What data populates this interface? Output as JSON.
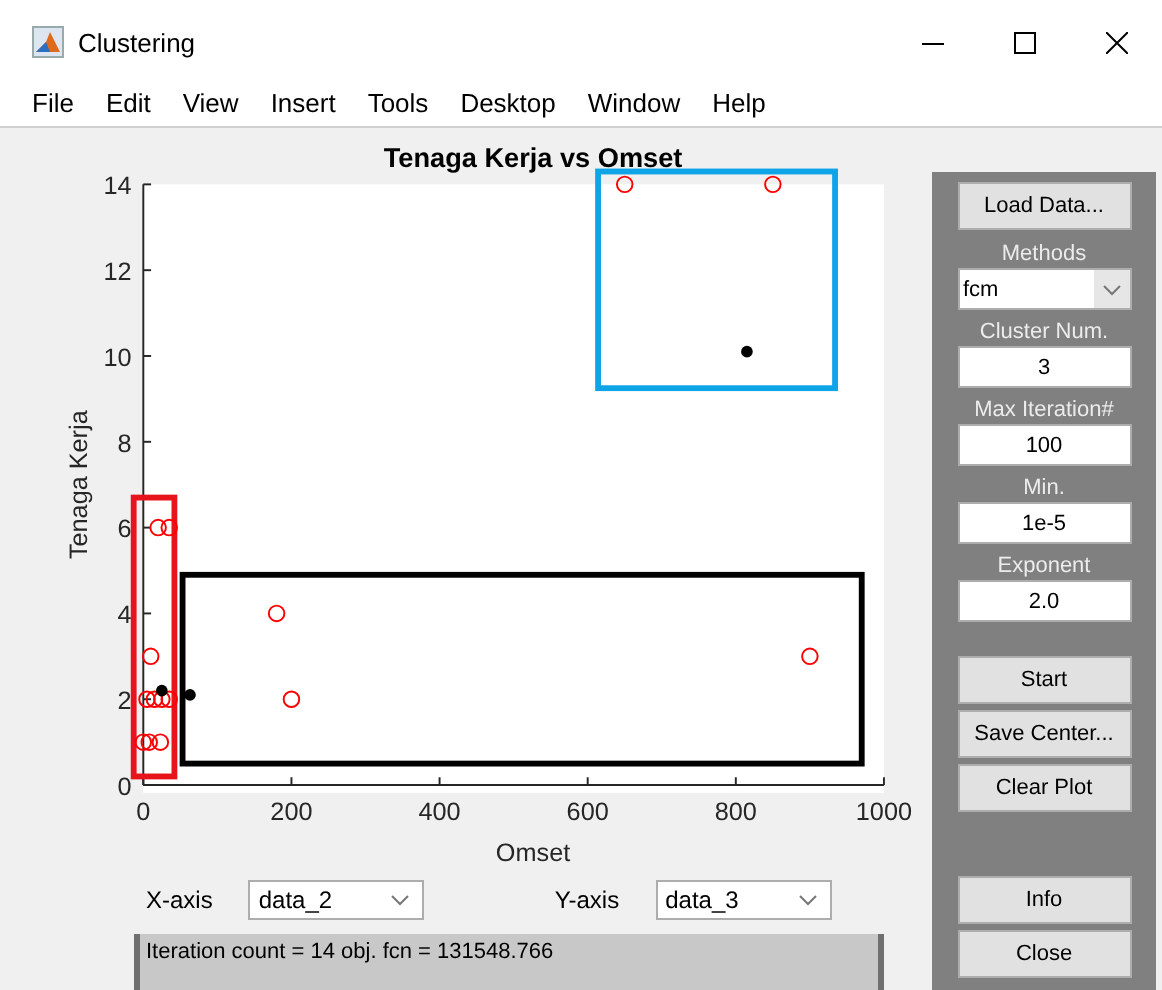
{
  "window": {
    "title": "Clustering"
  },
  "menu": [
    "File",
    "Edit",
    "View",
    "Insert",
    "Tools",
    "Desktop",
    "Window",
    "Help"
  ],
  "chart": {
    "chart_data": {
      "type": "scatter",
      "title": "Tenaga Kerja vs Omset",
      "xlabel": "Omset",
      "ylabel": "Tenaga Kerja",
      "xlim": [
        0,
        1000
      ],
      "ylim": [
        0,
        14
      ],
      "xticks": [
        0,
        200,
        400,
        600,
        800,
        1000
      ],
      "yticks": [
        0,
        2,
        4,
        6,
        8,
        10,
        12,
        14
      ],
      "series": [
        {
          "color": "#ff0000",
          "marker": "circle",
          "x": [
            650,
            850,
            180,
            200,
            900,
            10,
            20,
            35,
            5,
            15,
            25,
            35,
            0,
            8,
            23
          ],
          "values": [
            14,
            14,
            4,
            2,
            3,
            3,
            6,
            6,
            2,
            2,
            2,
            2,
            1,
            1,
            1
          ]
        },
        {
          "color": "#000000",
          "marker": "circle",
          "x": [
            25,
            63,
            815
          ],
          "values": [
            2.2,
            2.1,
            10.1
          ]
        }
      ]
    },
    "highlights": [
      {
        "color": "#e8141c"
      },
      {
        "color": "#000000"
      },
      {
        "color": "#0ea5e8"
      }
    ]
  },
  "axis_controls": [
    {
      "label": "X-axis",
      "value": "data_2"
    },
    {
      "label": "Y-axis",
      "value": "data_3"
    }
  ],
  "status": "Iteration count = 14 obj. fcn = 131548.766",
  "panel": {
    "load_button": "Load Data...",
    "methods": {
      "label": "Methods",
      "value": "fcm"
    },
    "fields": [
      {
        "label": "Cluster Num.",
        "value": "3"
      },
      {
        "label": "Max Iteration#",
        "value": "100"
      },
      {
        "label": "Min.",
        "value": "1e-5"
      },
      {
        "label": "Exponent",
        "value": "2.0"
      }
    ],
    "action_buttons": [
      "Start",
      "Save Center...",
      "Clear Plot"
    ],
    "bottom_buttons": [
      "Info",
      "Close"
    ]
  }
}
